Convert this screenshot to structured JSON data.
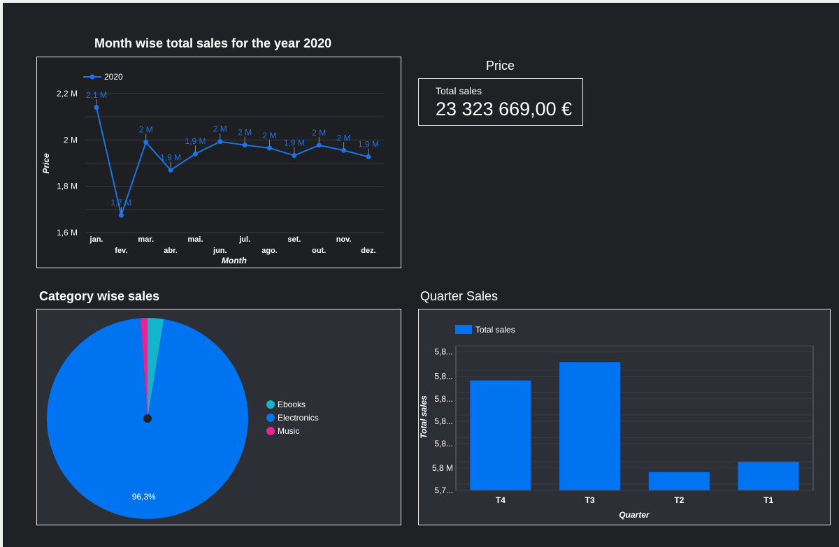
{
  "line_chart": {
    "title": "Month wise total sales for the year 2020"
  },
  "scorecard": {
    "header": "Price",
    "label": "Total sales",
    "value": "23 323 669,00 €"
  },
  "pie_chart": {
    "title": "Category wise sales"
  },
  "bar_chart": {
    "title": "Quarter Sales"
  },
  "colors": {
    "line": "#1a73e8",
    "bar": "#0073f0",
    "ebooks": "#12b5cb",
    "electronics": "#0073f0",
    "music": "#e52592"
  },
  "chart_data": [
    {
      "type": "line",
      "title": "Month wise total sales for the year 2020",
      "xlabel": "Month",
      "ylabel": "Price",
      "categories": [
        "jan.",
        "fev.",
        "mar.",
        "abr.",
        "mai.",
        "jun.",
        "jul.",
        "ago.",
        "set.",
        "out.",
        "nov.",
        "dez."
      ],
      "series": [
        {
          "name": "2020",
          "values": [
            2140000,
            1675000,
            1990000,
            1870000,
            1940000,
            1993000,
            1978000,
            1965000,
            1933000,
            1977000,
            1955000,
            1927000
          ],
          "labels": [
            "2,1 M",
            "1,7 M",
            "2 M",
            "1,9 M",
            "1,9 M",
            "2 M",
            "2 M",
            "2 M",
            "1,9 M",
            "2 M",
            "2 M",
            "1,9 M"
          ]
        }
      ],
      "ylim": [
        1600000,
        2200000
      ],
      "yticks": [
        1600000,
        1800000,
        2000000,
        2200000
      ],
      "ytick_labels": [
        "1,6 M",
        "1,8 M",
        "2 M",
        "2,2 M"
      ],
      "grid": true,
      "legend": "top-left"
    },
    {
      "type": "pie",
      "title": "Category wise sales",
      "categories": [
        "Ebooks",
        "Electronics",
        "Music"
      ],
      "values": [
        2.6,
        96.3,
        1.1
      ],
      "slice_labels": [
        "",
        "96,3%",
        ""
      ],
      "legend": "right",
      "donut_center_dot": true
    },
    {
      "type": "bar",
      "title": "Quarter Sales",
      "xlabel": "Quarter",
      "ylabel": "Total sales",
      "categories": [
        "T4",
        "T3",
        "T2",
        "T1"
      ],
      "series": [
        {
          "name": "Total sales",
          "values": [
            5836000,
            5845000,
            5791000,
            5796000
          ]
        }
      ],
      "ylim": [
        5782000,
        5853000
      ],
      "yticks": [
        5782000,
        5793000,
        5805000,
        5816000,
        5827000,
        5838000,
        5850000
      ],
      "ytick_labels": [
        "5,7...",
        "5,8 M",
        "5,8...",
        "5,8...",
        "5,8...",
        "5,8...",
        "5,8..."
      ],
      "grid": true,
      "legend": "top-left"
    }
  ]
}
